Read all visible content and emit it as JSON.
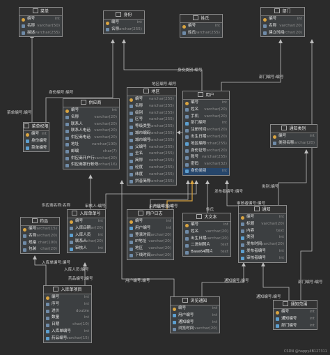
{
  "tables": [
    {
      "id": "menu",
      "title": "菜单",
      "cols": [
        [
          "pk",
          "编号",
          "int"
        ],
        [
          "c",
          "名称",
          "varchar(50)"
        ],
        [
          "c",
          "描述",
          "varchar(255)"
        ]
      ]
    },
    {
      "id": "identity",
      "title": "身份",
      "cols": [
        [
          "pk",
          "编号",
          "int"
        ],
        [
          "c",
          "名称",
          "varchar(255)"
        ]
      ]
    },
    {
      "id": "surname",
      "title": "姓氏",
      "cols": [
        [
          "pk",
          "编号",
          "int"
        ],
        [
          "c",
          "姓氏",
          "varchar(255)"
        ]
      ]
    },
    {
      "id": "dept",
      "title": "部门",
      "cols": [
        [
          "pk",
          "编号",
          "int"
        ],
        [
          "c",
          "名称",
          "varchar(20)"
        ],
        [
          "c",
          "建立时间",
          "varchar(20)"
        ]
      ]
    },
    {
      "id": "menuperm",
      "title": "菜单权限",
      "cols": [
        [
          "pk",
          "编号",
          "int"
        ],
        [
          "fk",
          "身份编号",
          "int"
        ],
        [
          "fk",
          "菜单编号",
          "int"
        ]
      ]
    },
    {
      "id": "supplier",
      "title": "供应商",
      "cols": [
        [
          "pk",
          "编号",
          "int"
        ],
        [
          "c",
          "名称",
          "varchar(20)"
        ],
        [
          "c",
          "联系人",
          "varchar(20)"
        ],
        [
          "c",
          "联系人电话",
          "varchar(20)"
        ],
        [
          "c",
          "供应商电话",
          "varchar(20)"
        ],
        [
          "c",
          "地址",
          "varchar(100)"
        ],
        [
          "c",
          "邮编",
          "char(7)"
        ],
        [
          "c",
          "供应商开户行",
          "varchar(20)"
        ],
        [
          "c",
          "供应商银行帐号",
          "varchar(16)"
        ]
      ]
    },
    {
      "id": "region",
      "title": "地区",
      "cols": [
        [
          "pk",
          "编号",
          "varchar(255)"
        ],
        [
          "c",
          "名称",
          "varchar(255)"
        ],
        [
          "c",
          "级别",
          "varchar(255)"
        ],
        [
          "c",
          "区号",
          "varchar(255)"
        ],
        [
          "c",
          "等级类型",
          "varchar(255)"
        ],
        [
          "c",
          "城市编码",
          "varchar(255)"
        ],
        [
          "c",
          "城市编号",
          "varchar(255)"
        ],
        [
          "c",
          "父编号",
          "varchar(255)"
        ],
        [
          "c",
          "全名",
          "varchar(255)"
        ],
        [
          "c",
          "简称",
          "varchar(255)"
        ],
        [
          "c",
          "经度",
          "varchar(255)"
        ],
        [
          "c",
          "纬度",
          "varchar(255)"
        ],
        [
          "c",
          "拼音简称",
          "varchar(255)"
        ]
      ]
    },
    {
      "id": "user",
      "title": "用户",
      "cols": [
        [
          "pk",
          "编号",
          "int"
        ],
        [
          "c",
          "姓名",
          "varchar(20)"
        ],
        [
          "c",
          "手机",
          "varchar(20)"
        ],
        [
          "fk",
          "部门编号",
          "int"
        ],
        [
          "c",
          "注册时间",
          "varchar(20)"
        ],
        [
          "c",
          "出生日期",
          "varchar(20)"
        ],
        [
          "fk",
          "地区编号",
          "varchar(255)"
        ],
        [
          "c",
          "身份证号",
          "varchar(20)"
        ],
        [
          "c",
          "账号",
          "varchar(255)"
        ],
        [
          "c",
          "密码",
          "varchar(32)"
        ],
        [
          "fk",
          "身份类别",
          "int"
        ]
      ]
    },
    {
      "id": "notifycat",
      "title": "通知类别",
      "cols": [
        [
          "pk",
          "编号",
          "int"
        ],
        [
          "c",
          "类别名称",
          "varchar(20)"
        ]
      ]
    },
    {
      "id": "product",
      "title": "药品",
      "cols": [
        [
          "pk",
          "编号",
          "varchar(15)"
        ],
        [
          "c",
          "名称",
          "varchar(20)"
        ],
        [
          "c",
          "规格",
          "char(100)"
        ],
        [
          "c",
          "包装",
          "char(20)"
        ]
      ]
    },
    {
      "id": "inorder",
      "title": "入库单单号",
      "cols": [
        [
          "pk",
          "编号",
          "int"
        ],
        [
          "c",
          "入库日期",
          "varchar(20)"
        ],
        [
          "fk",
          "入库人员",
          "int"
        ],
        [
          "c",
          "联系人",
          "varchar(20)"
        ],
        [
          "fk",
          "审核人",
          "int"
        ]
      ]
    },
    {
      "id": "userlog",
      "title": "用户日志",
      "cols": [
        [
          "pk",
          "编号",
          "int"
        ],
        [
          "fk",
          "用户编号",
          "int"
        ],
        [
          "c",
          "登录时间",
          "varchar(20)"
        ],
        [
          "c",
          "IP地址",
          "varchar(20)"
        ],
        [
          "c",
          "地区",
          "varchar(20)"
        ],
        [
          "c",
          "下线时间",
          "varchar(20)"
        ]
      ]
    },
    {
      "id": "bigtext",
      "title": "大文本",
      "cols": [
        [
          "pk",
          "编号",
          "int"
        ],
        [
          "c",
          "姓名",
          "varchar(20)"
        ],
        [
          "c",
          "出生日期",
          "varchar(20)"
        ],
        [
          "c",
          "二进制照片",
          "text"
        ],
        [
          "c",
          "Base64照片",
          "text"
        ]
      ]
    },
    {
      "id": "notice",
      "title": "通知",
      "cols": [
        [
          "pk",
          "编号",
          "int"
        ],
        [
          "c",
          "标题",
          "varchar(20)"
        ],
        [
          "c",
          "内容",
          "text"
        ],
        [
          "fk",
          "类别",
          "int"
        ],
        [
          "c",
          "发布时间",
          "varchar(20)"
        ],
        [
          "fk",
          "发布者编号",
          "int"
        ],
        [
          "fk",
          "审核者编号",
          "int"
        ]
      ]
    },
    {
      "id": "initem",
      "title": "入库单项目",
      "cols": [
        [
          "pk",
          "编号",
          "int"
        ],
        [
          "c",
          "序号",
          "int"
        ],
        [
          "c",
          "进价",
          "double"
        ],
        [
          "c",
          "数量",
          "int"
        ],
        [
          "c",
          "日期",
          "char(10)"
        ],
        [
          "fk",
          "入库单编号",
          "int"
        ],
        [
          "fk",
          "药品编号",
          "varchar(15)"
        ]
      ]
    },
    {
      "id": "browse",
      "title": "浏览通知",
      "cols": [
        [
          "pk",
          "编号",
          "int"
        ],
        [
          "fk",
          "用户编号",
          "int"
        ],
        [
          "fk",
          "通知编号",
          "int"
        ],
        [
          "c",
          "浏览时间",
          "varchar(20)"
        ]
      ]
    },
    {
      "id": "notifyrange",
      "title": "通知范围",
      "cols": [
        [
          "pk",
          "编号",
          "int"
        ],
        [
          "fk",
          "通知编号",
          "int"
        ],
        [
          "fk",
          "部门编号",
          "int"
        ]
      ]
    }
  ],
  "relations": [
    "身份类别:编号",
    "部门编号:编号",
    "身份编号:编号",
    "菜单编号:编号",
    "地区编号:编号",
    "供应商名称:名称",
    "审核人:编号",
    "入库人员:编号",
    "用户编号:编号",
    "姓氏",
    "类别:编号",
    "发布者编号:编号",
    "审核者编号:编号",
    "入库单编号:编号",
    "药品编号:编号",
    "通知编号:编号"
  ],
  "watermark": "CSDN @happy4B127311",
  "colors": {
    "background": "#2b2b2b",
    "table": "#3c3f41",
    "line": "#bdbdbd",
    "highlight": "#d9a440"
  }
}
